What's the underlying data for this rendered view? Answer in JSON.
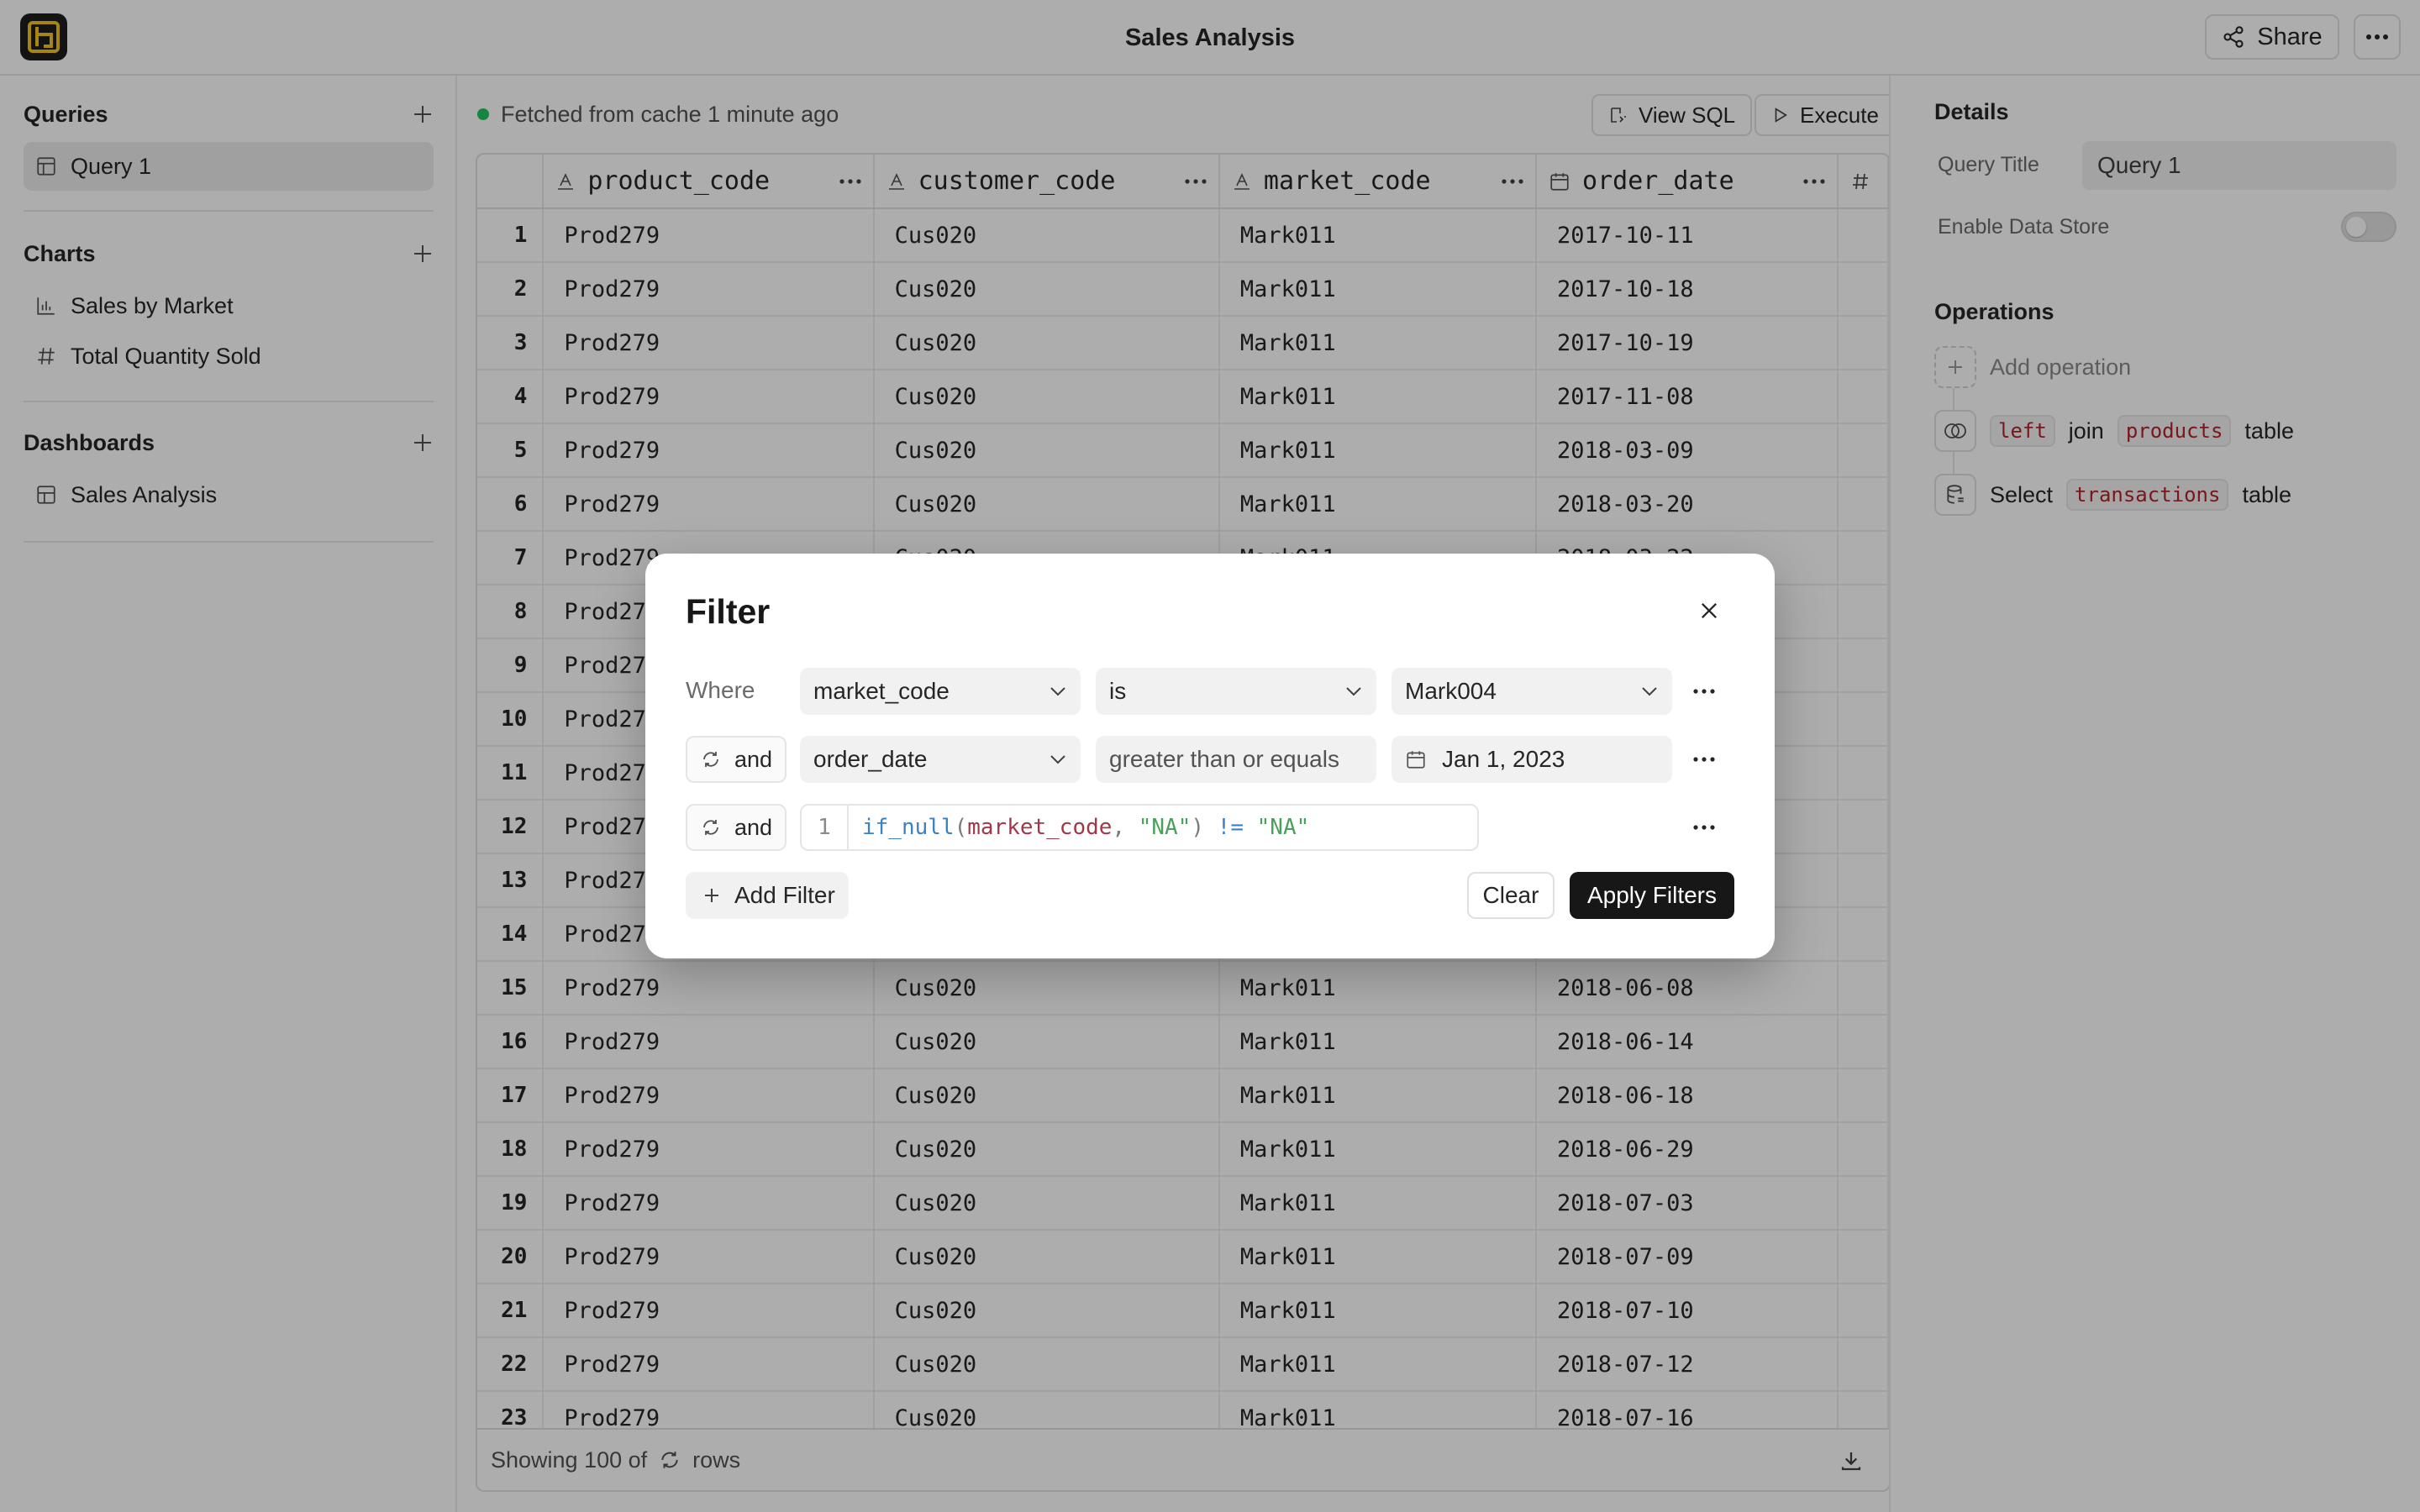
{
  "app": {
    "title": "Sales Analysis"
  },
  "topbar": {
    "share_label": "Share"
  },
  "sidebar": {
    "queries": {
      "title": "Queries",
      "items": [
        {
          "label": "Query 1"
        }
      ]
    },
    "charts": {
      "title": "Charts",
      "items": [
        {
          "label": "Sales by Market"
        },
        {
          "label": "Total Quantity Sold"
        }
      ]
    },
    "dashboards": {
      "title": "Dashboards",
      "items": [
        {
          "label": "Sales Analysis"
        }
      ]
    }
  },
  "main": {
    "status": "Fetched from cache 1 minute ago",
    "view_sql_label": "View SQL",
    "execute_label": "Execute",
    "columns": [
      {
        "name": "product_code",
        "type": "text"
      },
      {
        "name": "customer_code",
        "type": "text"
      },
      {
        "name": "market_code",
        "type": "text"
      },
      {
        "name": "order_date",
        "type": "date"
      },
      {
        "name": "",
        "type": "number"
      }
    ],
    "rows": [
      {
        "n": "1",
        "product": "Prod279",
        "customer": "Cus020",
        "market": "Mark011",
        "date": "2017-10-11"
      },
      {
        "n": "2",
        "product": "Prod279",
        "customer": "Cus020",
        "market": "Mark011",
        "date": "2017-10-18"
      },
      {
        "n": "3",
        "product": "Prod279",
        "customer": "Cus020",
        "market": "Mark011",
        "date": "2017-10-19"
      },
      {
        "n": "4",
        "product": "Prod279",
        "customer": "Cus020",
        "market": "Mark011",
        "date": "2017-11-08"
      },
      {
        "n": "5",
        "product": "Prod279",
        "customer": "Cus020",
        "market": "Mark011",
        "date": "2018-03-09"
      },
      {
        "n": "6",
        "product": "Prod279",
        "customer": "Cus020",
        "market": "Mark011",
        "date": "2018-03-20"
      },
      {
        "n": "7",
        "product": "Prod279",
        "customer": "Cus020",
        "market": "Mark011",
        "date": "2018-03-22"
      },
      {
        "n": "8",
        "product": "Prod279",
        "customer": "",
        "market": "",
        "date": ""
      },
      {
        "n": "9",
        "product": "Prod279",
        "customer": "",
        "market": "",
        "date": ""
      },
      {
        "n": "10",
        "product": "Prod279",
        "customer": "",
        "market": "",
        "date": ""
      },
      {
        "n": "11",
        "product": "Prod279",
        "customer": "",
        "market": "",
        "date": ""
      },
      {
        "n": "12",
        "product": "Prod279",
        "customer": "",
        "market": "",
        "date": ""
      },
      {
        "n": "13",
        "product": "Prod279",
        "customer": "",
        "market": "",
        "date": ""
      },
      {
        "n": "14",
        "product": "Prod279",
        "customer": "",
        "market": "",
        "date": ""
      },
      {
        "n": "15",
        "product": "Prod279",
        "customer": "Cus020",
        "market": "Mark011",
        "date": "2018-06-08"
      },
      {
        "n": "16",
        "product": "Prod279",
        "customer": "Cus020",
        "market": "Mark011",
        "date": "2018-06-14"
      },
      {
        "n": "17",
        "product": "Prod279",
        "customer": "Cus020",
        "market": "Mark011",
        "date": "2018-06-18"
      },
      {
        "n": "18",
        "product": "Prod279",
        "customer": "Cus020",
        "market": "Mark011",
        "date": "2018-06-29"
      },
      {
        "n": "19",
        "product": "Prod279",
        "customer": "Cus020",
        "market": "Mark011",
        "date": "2018-07-03"
      },
      {
        "n": "20",
        "product": "Prod279",
        "customer": "Cus020",
        "market": "Mark011",
        "date": "2018-07-09"
      },
      {
        "n": "21",
        "product": "Prod279",
        "customer": "Cus020",
        "market": "Mark011",
        "date": "2018-07-10"
      },
      {
        "n": "22",
        "product": "Prod279",
        "customer": "Cus020",
        "market": "Mark011",
        "date": "2018-07-12"
      },
      {
        "n": "23",
        "product": "Prod279",
        "customer": "Cus020",
        "market": "Mark011",
        "date": "2018-07-16"
      }
    ],
    "footer": {
      "showing": "Showing 100 of",
      "rows_word": "rows"
    }
  },
  "details": {
    "title": "Details",
    "query_title_label": "Query Title",
    "query_title_value": "Query 1",
    "data_store_label": "Enable Data Store",
    "data_store_enabled": false,
    "operations_title": "Operations",
    "add_operation_label": "Add operation",
    "op_join": {
      "kind": "left",
      "word": "join",
      "table": "products",
      "suffix": "table"
    },
    "op_select": {
      "word": "Select",
      "table": "transactions",
      "suffix": "table"
    }
  },
  "filter_modal": {
    "title": "Filter",
    "where_label": "Where",
    "row1": {
      "column": "market_code",
      "operator": "is",
      "value": "Mark004"
    },
    "row2": {
      "conj": "and",
      "column": "order_date",
      "operator": "greater than or equals",
      "value": "Jan 1, 2023"
    },
    "row3": {
      "conj": "and",
      "line_no": "1",
      "fn": "if_null",
      "arg": "market_code",
      "str1": "\"NA\"",
      "op": "!=",
      "str2": "\"NA\""
    },
    "add_filter_label": "Add Filter",
    "clear_label": "Clear",
    "apply_label": "Apply Filters"
  },
  "colors": {
    "accent": "#171717",
    "logo_mark": "#f5c518",
    "status_dot": "#22c55e",
    "chip_text": "#b4232a"
  }
}
